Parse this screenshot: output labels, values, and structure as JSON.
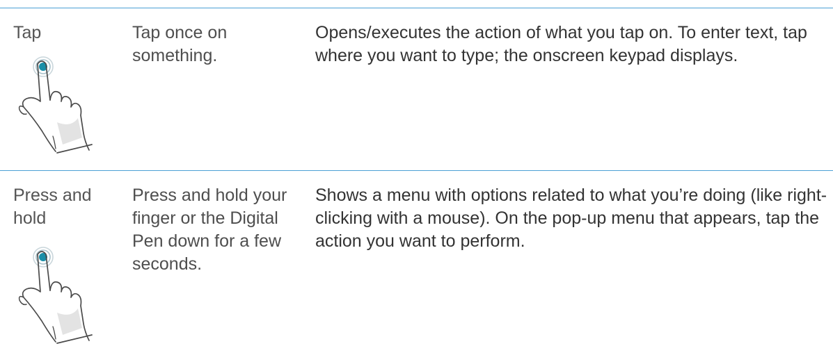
{
  "gestures": [
    {
      "name": "Tap",
      "action": "Tap once on something.",
      "result": "Opens/executes the action of what you tap on. To enter text, tap where you want to type; the onscreen keypad displays.",
      "icon": "tap-gesture-icon"
    },
    {
      "name": "Press and hold",
      "action": "Press and hold your finger or the Digital Pen down for a few seconds.",
      "result": "Shows a menu with options related to what you’re doing (like right-clicking with a mouse). On the pop-up menu that appears, tap the action you want to perform.",
      "icon": "press-and-hold-gesture-icon"
    }
  ],
  "colors": {
    "rule": "#4a9fd4",
    "touch_point": "#1a8fa8"
  }
}
